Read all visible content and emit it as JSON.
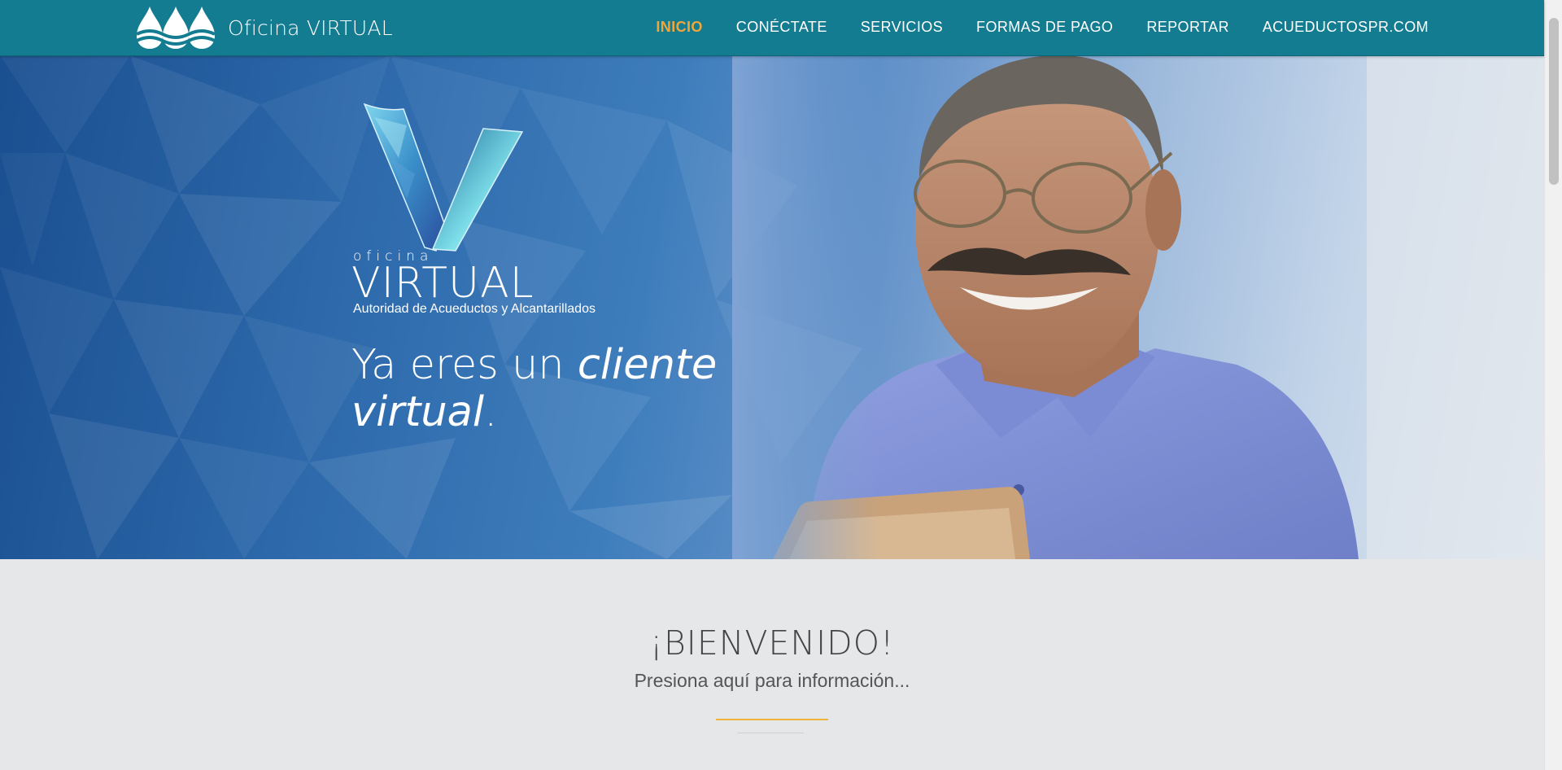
{
  "brand": {
    "name": "Oficina VIRTUAL",
    "logo_icon": "water-drops-logo"
  },
  "nav": {
    "items": [
      "INICIO",
      "CONÉCTATE",
      "SERVICIOS",
      "FORMAS DE PAGO",
      "REPORTAR",
      "ACUEDUCTOSPR.COM"
    ],
    "active": "INICIO",
    "active_color": "#f0a63a"
  },
  "hero": {
    "logo_small": "oficina",
    "logo_big": "VIRTUAL",
    "logo_sub": "Autoridad de Acueductos y Alcantarillados",
    "tagline_plain": "Ya eres un ",
    "tagline_italic_1": "cliente",
    "tagline_italic_2": "virtual",
    "tagline_end": "."
  },
  "welcome": {
    "title": "¡BIENVENIDO!",
    "link": "Presiona aquí para información..."
  },
  "colors": {
    "navbar": "#137c91",
    "accent": "#f0b43a",
    "background": "#e6e7e9"
  }
}
